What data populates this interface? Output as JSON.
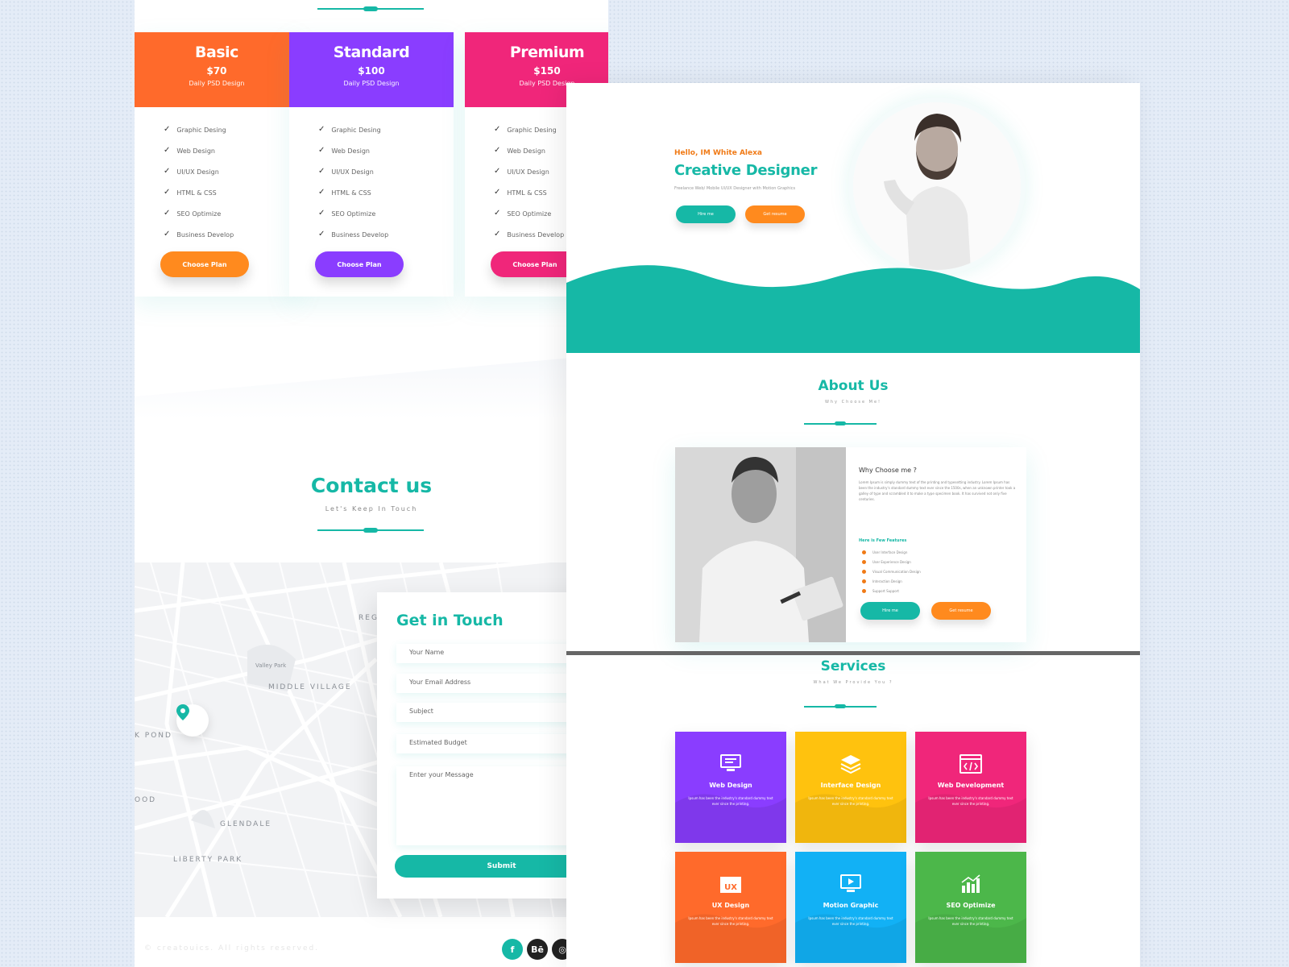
{
  "colors": {
    "teal": "#16b8a6",
    "orange": "#ff6a2b",
    "purple": "#8a3dff",
    "pink": "#f0267a",
    "yellow": "#ffc20e",
    "blue": "#12b1f5",
    "green": "#4cb74a"
  },
  "pricing": {
    "plans": [
      {
        "name": "Basic",
        "price": "$70",
        "subtitle": "Daily PSD Design",
        "button": "Choose Plan",
        "color": "#ff6a2b"
      },
      {
        "name": "Standard",
        "price": "$100",
        "subtitle": "Daily PSD Design",
        "button": "Choose Plan",
        "color": "#8a3dff"
      },
      {
        "name": "Premium",
        "price": "$150",
        "subtitle": "Daily PSD Design",
        "button": "Choose Plan",
        "color": "#f0267a"
      }
    ],
    "features": [
      "Graphic Desing",
      "Web Design",
      "UI/UX Design",
      "HTML & CSS",
      "SEO Optimize",
      "Business Develop"
    ]
  },
  "contact": {
    "title": "Contact us",
    "subtitle": "Let's Keep In Touch",
    "map_labels": [
      "MIDDLE VILLAGE",
      "GLENDALE",
      "LIBERTY PARK",
      "K POND",
      "OOD",
      "Valley Park",
      "REG"
    ],
    "form_title": "Get in Touch",
    "fields": {
      "name": "Your Name",
      "email": "Your Email Address",
      "subject": "Subject",
      "budget": "Estimated Budget",
      "message": "Enter your Message"
    },
    "submit": "Submit",
    "copyright": "© creatouics. All rights reserved."
  },
  "social": [
    {
      "icon": "facebook-icon",
      "glyph": "f",
      "color": "#16b8a6"
    },
    {
      "icon": "behance-icon",
      "glyph": "Bē",
      "color": "#222"
    },
    {
      "icon": "dribbble-icon",
      "glyph": "◎",
      "color": "#222"
    }
  ],
  "hero": {
    "greeting": "Hello, IM White Alexa",
    "title": "Creative Designer",
    "description": "Freelance Web/ Mobile UI/UX Designer with Motion Graphics",
    "btn_primary": "Hire me",
    "btn_secondary": "Get resume"
  },
  "about": {
    "title": "About Us",
    "subtitle": "Why Choose Me!",
    "heading": "Why Choose me ?",
    "text": "Lorem Ipsum is simply dummy text of the printing and typesetting industry. Lorem Ipsum has been the industry's standard dummy text ever since the 1500s, when an unknown printer took a galley of type and scrambled it to make a type specimen book. It has survived not only five centuries.",
    "features_title": "Here is Few Features",
    "features": [
      "User Interface Design",
      "User Experience Design",
      "Visual Communication Design",
      "Interaction Design",
      "Support Support"
    ],
    "btn_primary": "Hire me",
    "btn_secondary": "Get resume"
  },
  "services": {
    "title": "Services",
    "subtitle": "What We Provide You ?",
    "items": [
      {
        "name": "Web Design",
        "desc": "Ipsum has been the industry's standard dummy text ever since the printing.",
        "color": "#8a3dff",
        "icon": "web-design-icon"
      },
      {
        "name": "Interface Design",
        "desc": "Ipsum has been the industry's standard dummy text ever since the printing.",
        "color": "#ffc20e",
        "icon": "layers-icon"
      },
      {
        "name": "Web Development",
        "desc": "Ipsum has been the industry's standard dummy text ever since the printing.",
        "color": "#f0267a",
        "icon": "code-icon"
      },
      {
        "name": "UX Design",
        "desc": "Ipsum has been the industry's standard dummy text ever since the printing.",
        "color": "#ff6a2b",
        "icon": "ux-icon"
      },
      {
        "name": "Motion Graphic",
        "desc": "Ipsum has been the industry's standard dummy text ever since the printing.",
        "color": "#12b1f5",
        "icon": "monitor-play-icon"
      },
      {
        "name": "SEO Optimize",
        "desc": "Ipsum has been the industry's standard dummy text ever since the printing.",
        "color": "#4cb74a",
        "icon": "chart-bars-icon"
      }
    ]
  }
}
